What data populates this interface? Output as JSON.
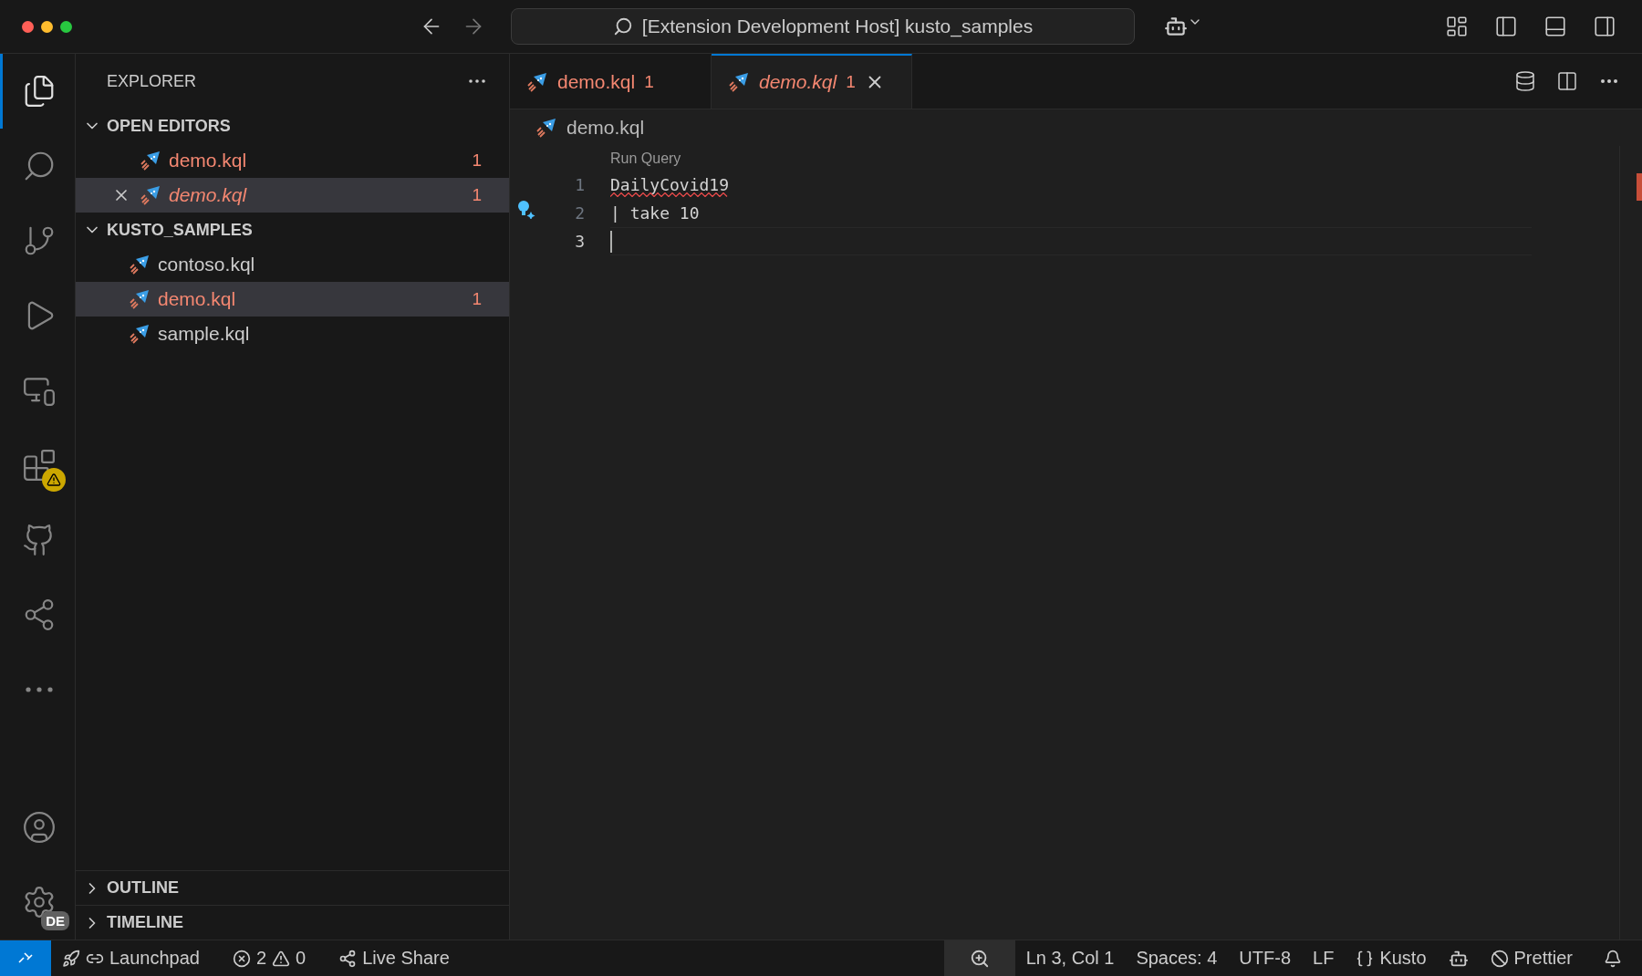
{
  "window": {
    "title": "[Extension Development Host] kusto_samples"
  },
  "activity_bar": {
    "items": [
      {
        "kind": "files",
        "selected": true
      },
      {
        "kind": "search",
        "selected": false
      },
      {
        "kind": "source-control",
        "selected": false
      },
      {
        "kind": "run",
        "selected": false
      },
      {
        "kind": "remote",
        "selected": false
      },
      {
        "kind": "extensions",
        "selected": false,
        "warning": true
      },
      {
        "kind": "github",
        "selected": false
      },
      {
        "kind": "live-share",
        "selected": false
      },
      {
        "kind": "more",
        "selected": false
      }
    ],
    "bottom": [
      {
        "kind": "account"
      },
      {
        "kind": "settings",
        "badge": "DE"
      }
    ]
  },
  "sidebar": {
    "title": "EXPLORER",
    "open_editors": {
      "title": "OPEN EDITORS",
      "expanded": true,
      "items": [
        {
          "name": "demo.kql",
          "problems": "1",
          "preview": false,
          "selected": false
        },
        {
          "name": "demo.kql",
          "problems": "1",
          "preview": true,
          "selected": true
        }
      ]
    },
    "folder": {
      "title": "KUSTO_SAMPLES",
      "expanded": true,
      "items": [
        {
          "name": "contoso.kql",
          "selected": false
        },
        {
          "name": "demo.kql",
          "problems": "1",
          "selected": true
        },
        {
          "name": "sample.kql",
          "selected": false
        }
      ]
    },
    "collapsed_sections": [
      {
        "title": "OUTLINE",
        "expanded": false
      },
      {
        "title": "TIMELINE",
        "expanded": false
      }
    ]
  },
  "tabs": [
    {
      "label": "demo.kql",
      "problems": "1",
      "preview": false,
      "selected": false
    },
    {
      "label": "demo.kql",
      "problems": "1",
      "preview": true,
      "selected": true
    }
  ],
  "breadcrumb": "demo.kql",
  "editor": {
    "codelens": "Run Query",
    "lines": [
      {
        "number": "1",
        "text": "DailyCovid19",
        "error": true,
        "current": false
      },
      {
        "number": "2",
        "text": "| take 10",
        "error": false,
        "current": false
      },
      {
        "number": "3",
        "error": false,
        "current": true
      }
    ]
  },
  "status_bar": {
    "left": [
      {
        "kind": "remote"
      },
      {
        "kind": "launchpad",
        "text": "Launchpad"
      },
      {
        "kind": "problems",
        "errors": "2",
        "warnings": "0"
      },
      {
        "kind": "live-share",
        "text": "Live Share"
      }
    ],
    "right": [
      {
        "kind": "zoom"
      },
      {
        "kind": "text",
        "text": "Ln 3, Col 1"
      },
      {
        "kind": "text",
        "text": "Spaces: 4"
      },
      {
        "kind": "text",
        "text": "UTF-8"
      },
      {
        "kind": "text",
        "text": "LF"
      },
      {
        "kind": "language",
        "text": "Kusto"
      },
      {
        "kind": "copilot"
      },
      {
        "kind": "prettier",
        "text": "Prettier"
      },
      {
        "kind": "bell"
      }
    ]
  }
}
